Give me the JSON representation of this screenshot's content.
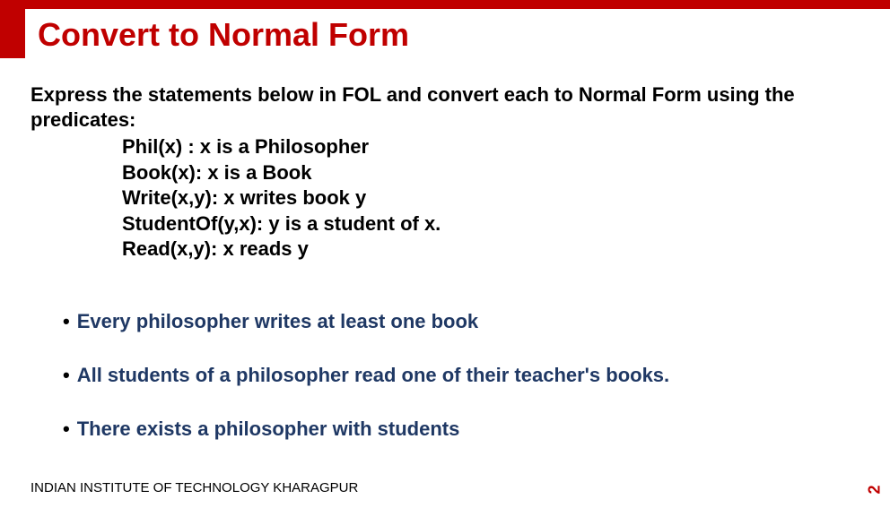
{
  "title": "Convert to Normal Form",
  "intro": "Express the statements below in FOL and convert each to Normal Form using the predicates:",
  "predicates": [
    "Phil(x) : x is a Philosopher",
    "Book(x): x is a Book",
    "Write(x,y): x writes book y",
    "StudentOf(y,x): y is a student of x.",
    "Read(x,y): x reads y"
  ],
  "bullets": [
    "Every philosopher writes at least one book",
    "All students of a philosopher read one of their teacher's books.",
    "There exists a philosopher with students"
  ],
  "footer": "INDIAN INSTITUTE OF TECHNOLOGY KHARAGPUR",
  "page_number": "2"
}
